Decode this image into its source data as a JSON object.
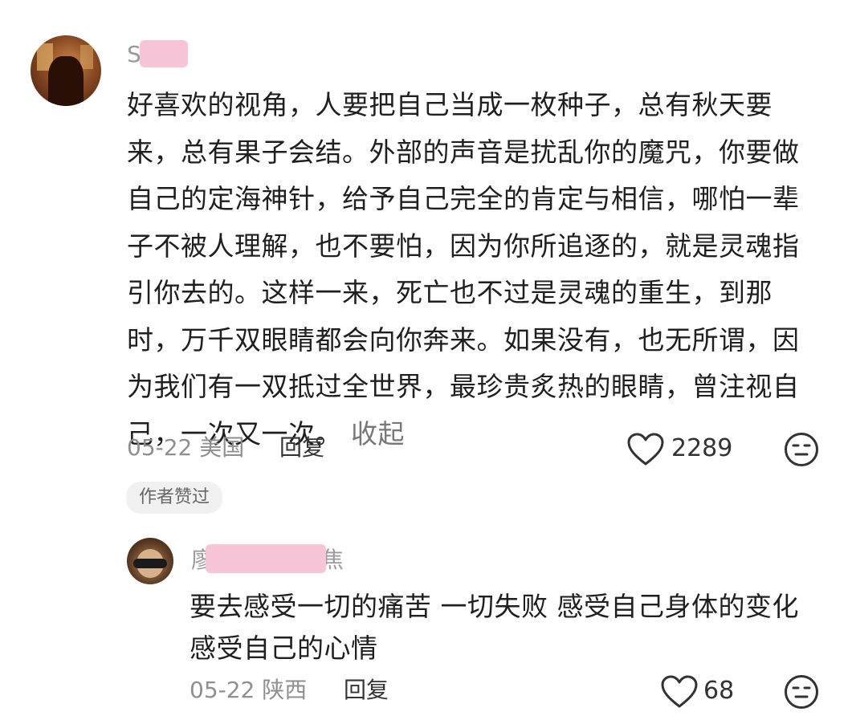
{
  "comment": {
    "username": "S",
    "text": "好喜欢的视角，人要把自己当成一枚种子，总有秋天要来，总有果子会结。外部的声音是扰乱你的魔咒，你要做自己的定海神针，给予自己完全的肯定与相信，哪怕一辈子不被人理解，也不要怕，因为你所追逐的，就是灵魂指引你去的。这样一来，死亡也不过是灵魂的重生，到那时，万千双眼睛都会向你奔来。如果没有，也无所谓，因为我们有一双抵过全世界，最珍贵炙热的眼睛，曾注视自己，一次又一次。",
    "collapse_label": "收起",
    "date": "05-22",
    "location": "美国",
    "reply_label": "回复",
    "like_count": "2289",
    "author_liked_badge": "作者赞过",
    "like_icon": "heart-outline-icon",
    "emoji_icon": "emoji-face-icon"
  },
  "reply": {
    "username_visible_start": "廖",
    "username_visible_end": "焦",
    "text": "要去感受一切的痛苦 一切失败 感受自己身体的变化 感受自己的心情",
    "date": "05-22",
    "location": "陕西",
    "reply_label": "回复",
    "like_count": "68",
    "like_icon": "heart-outline-icon",
    "emoji_icon": "emoji-face-icon"
  },
  "colors": {
    "redaction": "#f7c4d8",
    "meta_text": "#8f8f8f",
    "body_text": "#1f1f1f",
    "badge_bg": "#f1f1f1"
  }
}
